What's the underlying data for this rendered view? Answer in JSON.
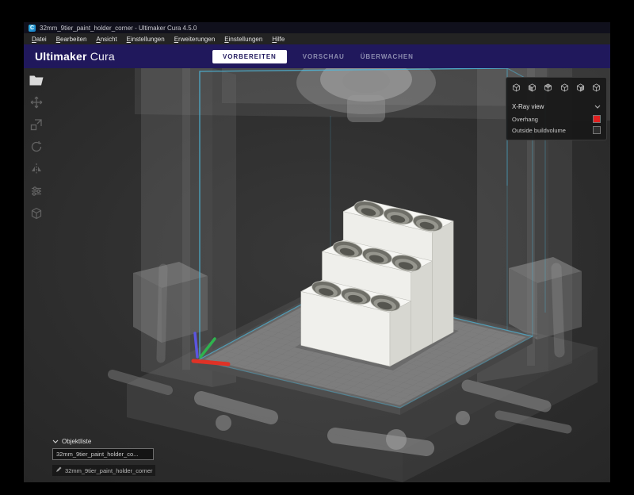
{
  "window": {
    "title": "32mm_9tier_paint_holder_corner - Ultimaker Cura 4.5.0"
  },
  "menubar": {
    "items": [
      {
        "label": "Datei"
      },
      {
        "label": "Bearbeiten"
      },
      {
        "label": "Ansicht"
      },
      {
        "label": "Einstellungen"
      },
      {
        "label": "Erweiterungen"
      },
      {
        "label": "Einstellungen"
      },
      {
        "label": "Hilfe"
      }
    ]
  },
  "header": {
    "brand": {
      "bold": "Ultimaker",
      "light": "Cura"
    },
    "tabs": [
      {
        "label": "VORBEREITEN",
        "active": true
      },
      {
        "label": "VORSCHAU",
        "active": false
      },
      {
        "label": "ÜBERWACHEN",
        "active": false
      }
    ]
  },
  "view_panel": {
    "dropdown": {
      "label": "X-Ray view"
    },
    "legend": [
      {
        "label": "Overhang",
        "color": "#e02020"
      },
      {
        "label": "Outside buildvolume",
        "color": "#2e2e2e"
      }
    ]
  },
  "object_list": {
    "title": "Objektliste",
    "selected_item": "32mm_9tier_paint_holder_co...",
    "item_name": "32mm_9tier_paint_holder_corner"
  },
  "colors": {
    "header_bg": "#20185c",
    "build_volume_blue": "#4db8dc",
    "axis_red": "#e03226",
    "axis_green": "#2fb34e",
    "axis_blue": "#5b55e0"
  }
}
